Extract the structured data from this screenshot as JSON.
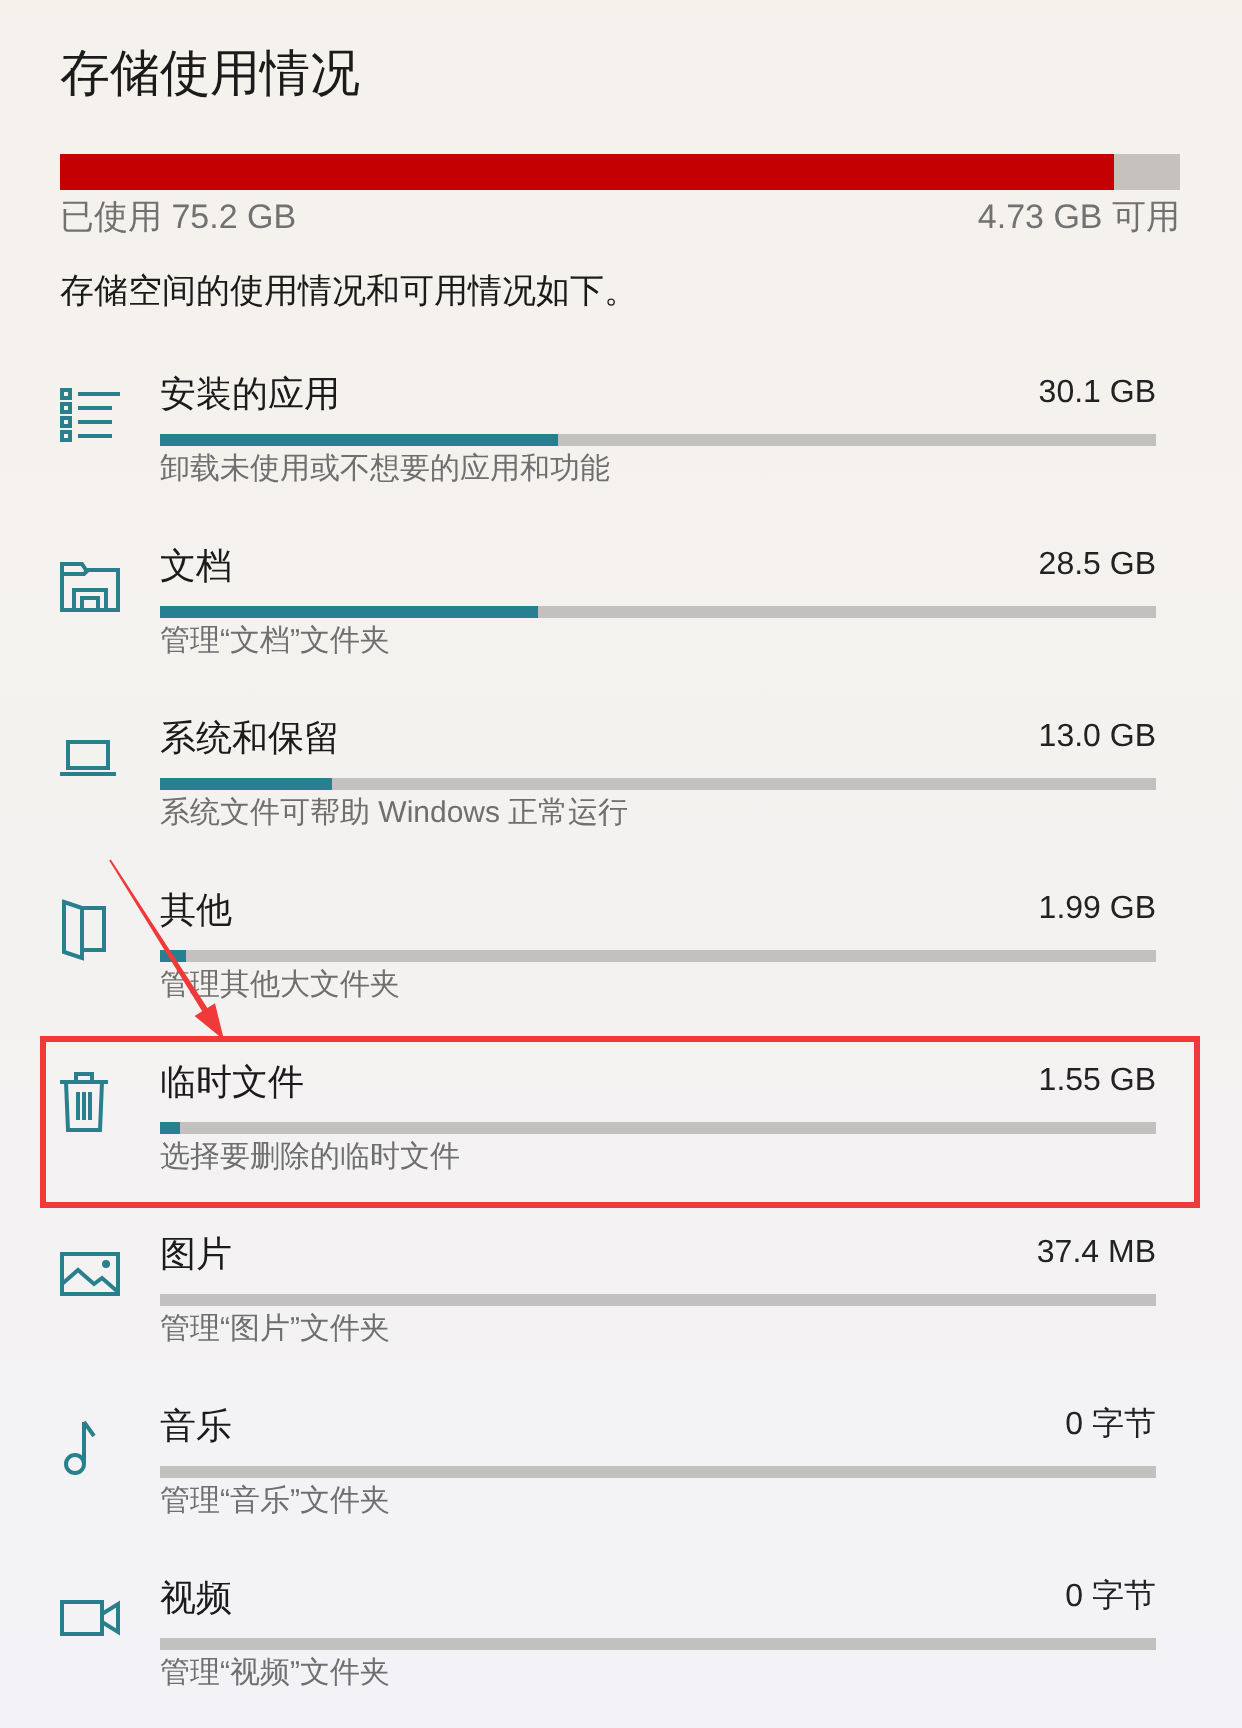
{
  "title": "存储使用情况",
  "usage": {
    "level": 0.941,
    "used": "已使用 75.2 GB",
    "free": "4.73 GB 可用"
  },
  "description": "存储空间的使用情况和可用情况如下。",
  "categories": [
    {
      "kind": "apps",
      "name": "安装的应用",
      "size": "30.1 GB",
      "level": 0.4,
      "detail": "卸载未使用或不想要的应用和功能",
      "highlighted": false
    },
    {
      "kind": "documents",
      "name": "文档",
      "size": "28.5 GB",
      "level": 0.38,
      "detail": "管理“文档”文件夹",
      "highlighted": false
    },
    {
      "kind": "system",
      "name": "系统和保留",
      "size": "13.0 GB",
      "level": 0.173,
      "detail": "系统文件可帮助 Windows 正常运行",
      "highlighted": false
    },
    {
      "kind": "other",
      "name": "其他",
      "size": "1.99 GB",
      "level": 0.026,
      "detail": "管理其他大文件夹",
      "highlighted": false
    },
    {
      "kind": "temp",
      "name": "临时文件",
      "size": "1.55 GB",
      "level": 0.02,
      "detail": "选择要删除的临时文件",
      "highlighted": true
    },
    {
      "kind": "pictures",
      "name": "图片",
      "size": "37.4 MB",
      "detail": "管理“图片”文件夹",
      "highlighted": false
    },
    {
      "kind": "music",
      "name": "音乐",
      "size": "0 字节",
      "detail": "管理“音乐”文件夹",
      "highlighted": false
    },
    {
      "kind": "videos",
      "name": "视频",
      "size": "0 字节",
      "detail": "管理“视频”文件夹",
      "highlighted": false
    }
  ]
}
